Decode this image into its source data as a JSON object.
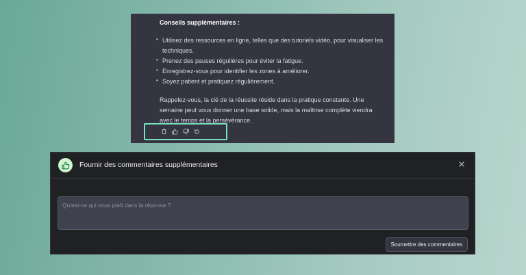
{
  "response": {
    "heading": "Conseils supplémentaires :",
    "tips": [
      "Utilisez des ressources en ligne, telles que des tutoriels vidéo, pour visualiser les techniques.",
      "Prenez des pauses régulières pour éviter la fatigue.",
      "Enregistrez-vous pour identifier les zones à améliorer.",
      "Soyez patient et pratiquez régulièrement."
    ],
    "conclusion": "Rappelez-vous, la clé de la réussite réside dans la pratique constante. Une semaine peut vous donner une base solide, mais la maîtrise complète viendra avec le temps et la persévérance.",
    "actions": [
      "copy-icon",
      "thumbs-up-icon",
      "thumbs-down-icon",
      "regenerate-icon"
    ],
    "highlight_color": "#77e3bd"
  },
  "modal": {
    "title": "Fournir des commentaires supplémentaires",
    "badge_icon": "thumbs-up-icon",
    "badge_color": "#d2f4d3",
    "close_icon": "close-icon",
    "textarea_placeholder": "Qu'est-ce qui vous plaît dans la réponse ?",
    "textarea_value": "",
    "submit_label": "Soumettre des commentaires"
  }
}
